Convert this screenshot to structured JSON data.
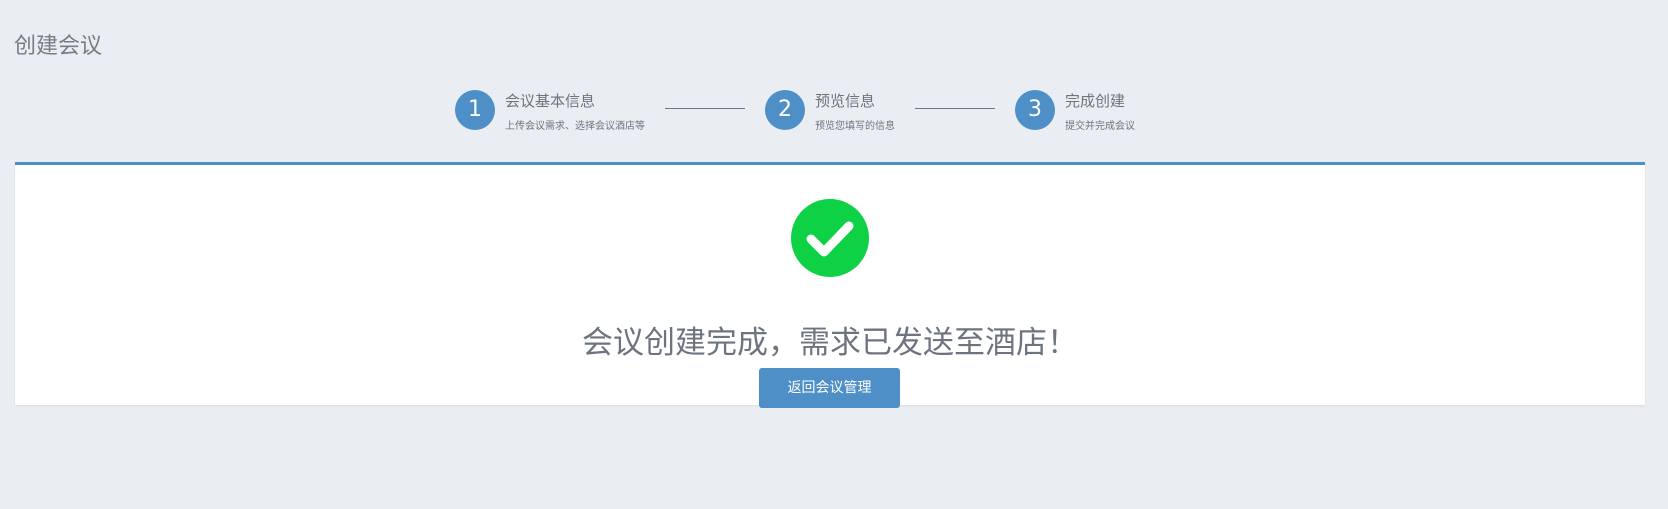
{
  "page": {
    "title": "创建会议"
  },
  "steps": [
    {
      "number": "1",
      "title": "会议基本信息",
      "subtitle": "上传会议需求、选择会议酒店等"
    },
    {
      "number": "2",
      "title": "预览信息",
      "subtitle": "预览您填写的信息"
    },
    {
      "number": "3",
      "title": "完成创建",
      "subtitle": "提交并完成会议"
    }
  ],
  "result": {
    "icon": "check-circle-icon",
    "message": "会议创建完成，需求已发送至酒店！",
    "button_label": "返回会议管理"
  },
  "colors": {
    "background": "#eaeef3",
    "accent": "#4d8fc6",
    "success": "#0ed145",
    "text": "#6d7480"
  }
}
